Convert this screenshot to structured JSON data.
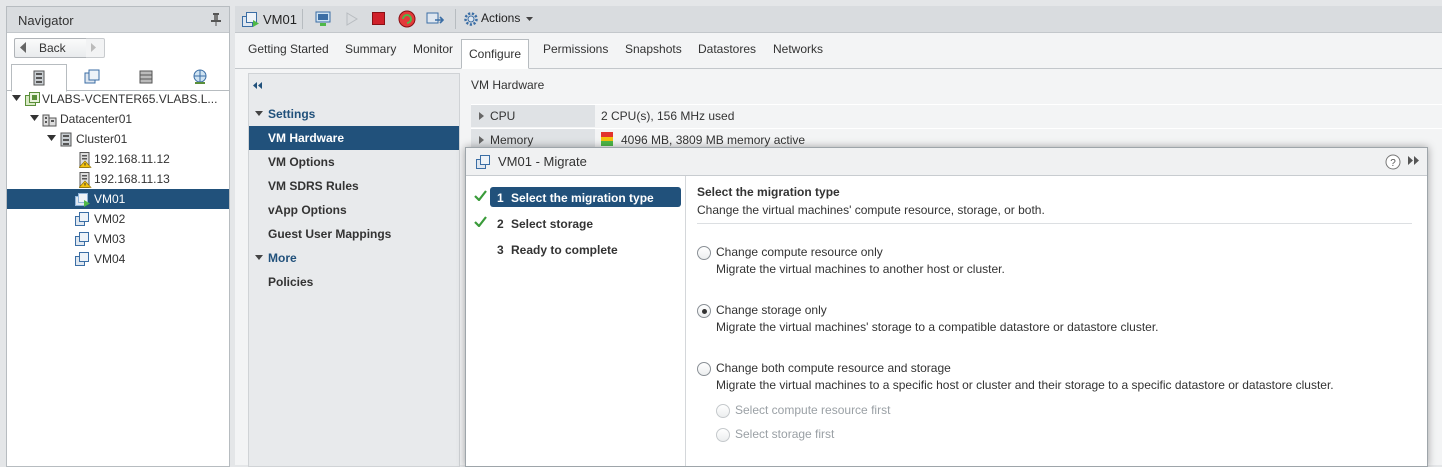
{
  "navigator": {
    "title": "Navigator",
    "back_label": "Back",
    "tabs": [
      "hosts-clusters",
      "vms-templates",
      "storage",
      "networking"
    ],
    "tree": [
      {
        "label": "VLABS-VCENTER65.VLABS.L...",
        "level": 0,
        "icon": "vcenter-icon"
      },
      {
        "label": "Datacenter01",
        "level": 1,
        "icon": "datacenter-icon"
      },
      {
        "label": "Cluster01",
        "level": 2,
        "icon": "cluster-icon"
      },
      {
        "label": "192.168.11.12",
        "level": 3,
        "icon": "host-warning-icon"
      },
      {
        "label": "192.168.11.13",
        "level": 3,
        "icon": "host-warning-icon"
      },
      {
        "label": "VM01",
        "level": 3,
        "icon": "vm-running-icon",
        "selected": true
      },
      {
        "label": "VM02",
        "level": 3,
        "icon": "vm-icon"
      },
      {
        "label": "VM03",
        "level": 3,
        "icon": "vm-icon"
      },
      {
        "label": "VM04",
        "level": 3,
        "icon": "vm-icon"
      }
    ]
  },
  "toolbar": {
    "vm_label": "VM01",
    "actions_label": "Actions"
  },
  "tabs": [
    {
      "label": "Getting Started"
    },
    {
      "label": "Summary"
    },
    {
      "label": "Monitor"
    },
    {
      "label": "Configure",
      "active": true
    },
    {
      "label": "Permissions"
    },
    {
      "label": "Snapshots"
    },
    {
      "label": "Datastores"
    },
    {
      "label": "Networks"
    }
  ],
  "settings": {
    "group_settings": "Settings",
    "items": [
      "VM Hardware",
      "VM Options",
      "VM SDRS Rules",
      "vApp Options",
      "Guest User Mappings"
    ],
    "selected": "VM Hardware",
    "group_more": "More",
    "more_items": [
      "Policies"
    ]
  },
  "hardware": {
    "title": "VM Hardware",
    "rows": [
      {
        "key": "CPU",
        "value": "2 CPU(s), 156 MHz used"
      },
      {
        "key": "Memory",
        "value": "4096 MB, 3809 MB memory active"
      }
    ]
  },
  "dialog": {
    "title": "VM01 - Migrate",
    "steps": [
      {
        "num": "1",
        "label": "Select the migration type",
        "done": true,
        "active": true
      },
      {
        "num": "2",
        "label": "Select storage",
        "done": true,
        "active": false
      },
      {
        "num": "3",
        "label": "Ready to complete",
        "done": false,
        "active": false
      }
    ],
    "content_title": "Select the migration type",
    "content_subtitle": "Change the virtual machines' compute resource, storage, or both.",
    "options": [
      {
        "label": "Change compute resource only",
        "desc": "Migrate the virtual machines to another host or cluster.",
        "checked": false
      },
      {
        "label": "Change storage only",
        "desc": "Migrate the virtual machines' storage to a compatible datastore or datastore cluster.",
        "checked": true
      },
      {
        "label": "Change both compute resource and storage",
        "desc": "Migrate the virtual machines to a specific host or cluster and their storage to a specific datastore or datastore cluster.",
        "checked": false
      }
    ],
    "sub_options": [
      {
        "label": "Select compute resource first",
        "disabled": true
      },
      {
        "label": "Select storage first",
        "disabled": true
      }
    ]
  },
  "colors": {
    "selection": "#21517b",
    "check_green": "#3a9b3a"
  }
}
